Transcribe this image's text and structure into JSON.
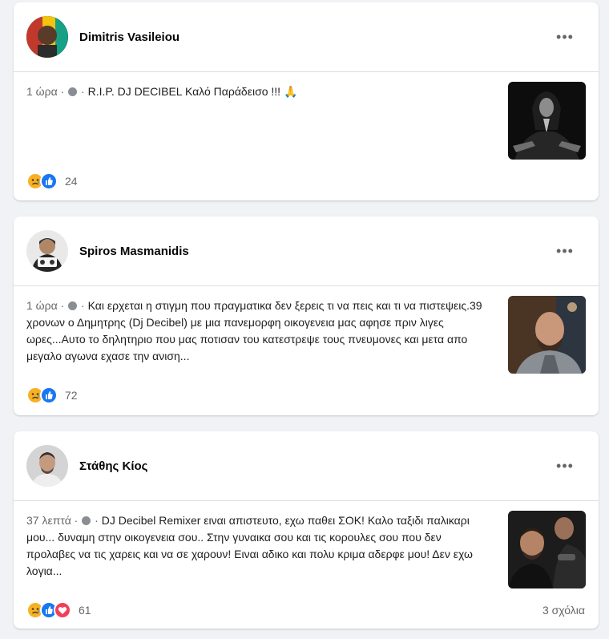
{
  "posts": [
    {
      "author": "Dimitris Vasileiou",
      "time": "1 ώρα",
      "text": "R.I.P. DJ DECIBEL Καλό Παράδεισο !!! 🙏",
      "reaction_count": "24",
      "reactions": [
        "sad-icon",
        "like-icon"
      ],
      "more": "•••"
    },
    {
      "author": "Spiros Masmanidis",
      "time": "1 ώρα",
      "text": "Και ερχεται η στιγμη που πραγματικα δεν ξερεις τι να πεις και τι να πιστεψεις.39 χρονων ο Δημητρης (Dj Decibel) με μια πανεμορφη οικογενεια μας αφησε πριν λιγες ωρες...Αυτο το δηλητηριο που μας ποτισαν του κατεστρεψε τους πνευμονες και μετα απο μεγαλο αγωνα εχασε την ανιση...",
      "reaction_count": "72",
      "reactions": [
        "sad-icon",
        "like-icon"
      ],
      "more": "•••"
    },
    {
      "author": "Στάθης Κίος",
      "time": "37 λεπτά",
      "text": "DJ Decibel Remixer ειναι απιστευτο, εχω παθει ΣΟΚ! Καλο ταξιδι παλικαρι μου... δυναμη στην οικογενεια σου.. Στην γυναικα σου και τις κορουλες σου που δεν προλαβες να τις χαρεις και να σε χαρουν! Ειναι αδικο και πολυ κριμα αδερφε μου! Δεν εχω λογια...",
      "reaction_count": "61",
      "reactions": [
        "sad-icon",
        "like-icon",
        "love-icon"
      ],
      "comments": "3 σχόλια",
      "more": "•••"
    }
  ],
  "separator": " · ",
  "colors": {
    "like": "#1877f2",
    "love": "#f33e58",
    "sad": "#f7b125",
    "meta_text": "#65676b",
    "background": "#f0f2f5"
  }
}
